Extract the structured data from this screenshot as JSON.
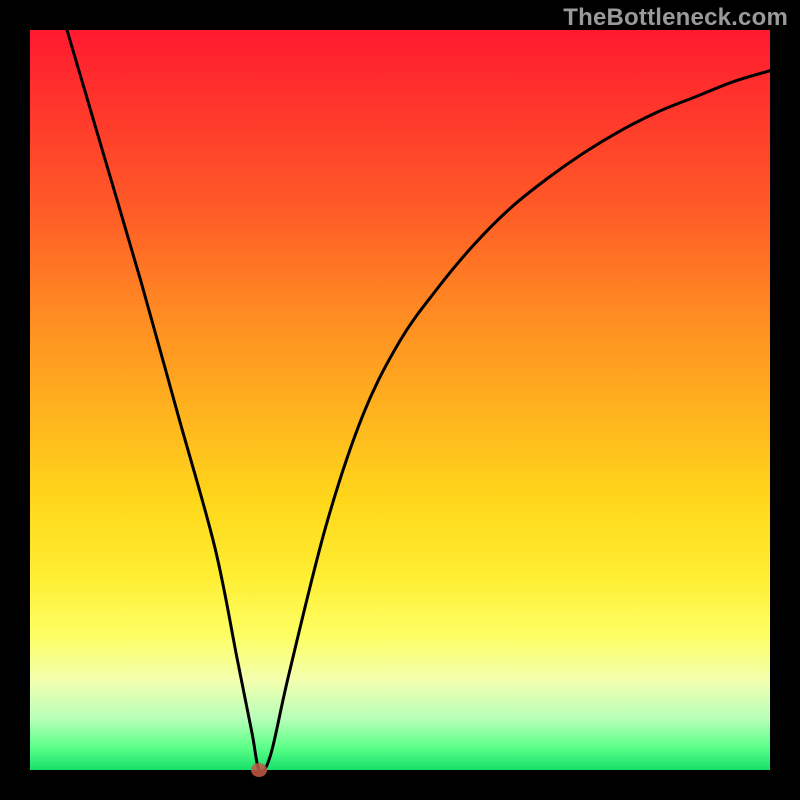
{
  "watermark": "TheBottleneck.com",
  "chart_data": {
    "type": "line",
    "title": "",
    "xlabel": "",
    "ylabel": "",
    "xlim": [
      0,
      100
    ],
    "ylim": [
      0,
      100
    ],
    "series": [
      {
        "name": "curve",
        "x": [
          5,
          10,
          15,
          20,
          25,
          28,
          30,
          31,
          32.5,
          35,
          40,
          45,
          50,
          55,
          60,
          65,
          70,
          75,
          80,
          85,
          90,
          95,
          100
        ],
        "values": [
          100,
          83,
          66,
          48,
          30,
          15,
          5,
          0,
          2,
          13,
          33,
          48,
          58,
          65,
          71,
          76,
          80,
          83.5,
          86.5,
          89,
          91,
          93,
          94.5
        ]
      }
    ],
    "marker": {
      "x": 31,
      "y": 0
    },
    "background_gradient": {
      "top": "#ff1a2f",
      "mid": "#ffd81a",
      "bottom": "#16e06a"
    }
  }
}
